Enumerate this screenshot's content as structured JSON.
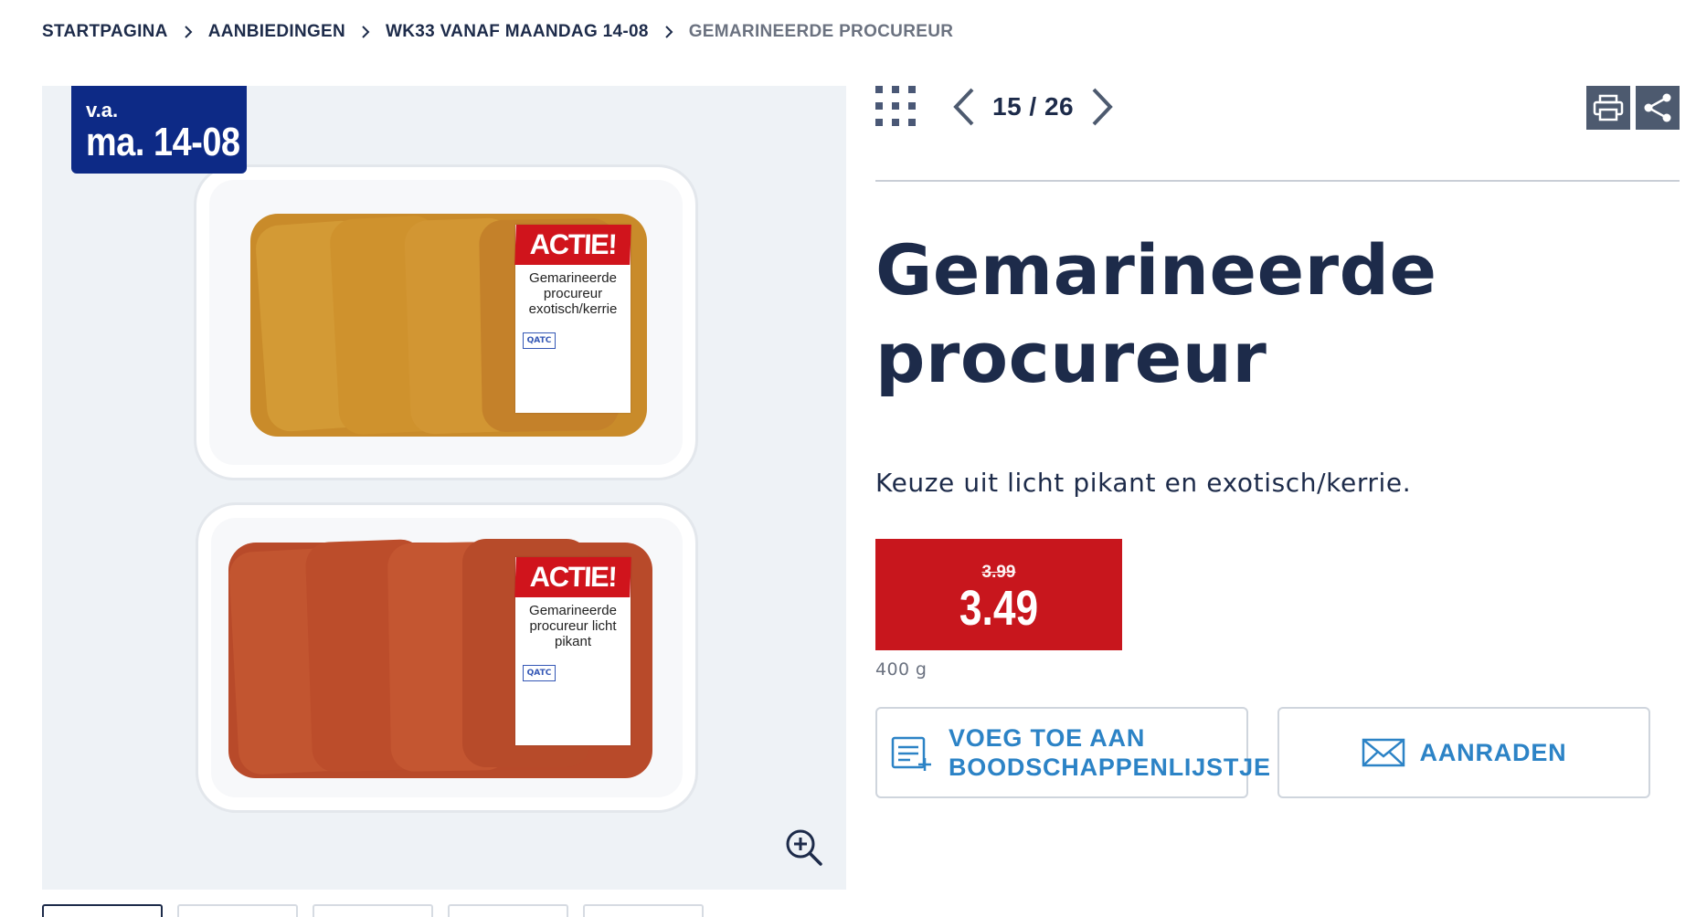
{
  "breadcrumb": {
    "items": [
      {
        "label": "STARTPAGINA"
      },
      {
        "label": "AANBIEDINGEN"
      },
      {
        "label": "WK33 VANAF MAANDAG 14-08"
      },
      {
        "label": "GEMARINEERDE PROCUREUR"
      }
    ]
  },
  "gallery": {
    "badge_prefix": "v.a.",
    "badge_date": "ma. 14-08",
    "zoom_icon": "zoom-in-icon",
    "labels": {
      "top": {
        "badge": "ACTIE!",
        "text": "Gemarineerde procureur exotisch/kerrie"
      },
      "bottom": {
        "badge": "ACTIE!",
        "text": "Gemarineerde procureur licht pikant"
      },
      "qa": "QATC"
    },
    "thumbnail_count": 5
  },
  "toolbar": {
    "grid_icon": "grid-icon",
    "prev_icon": "chevron-left-icon",
    "next_icon": "chevron-right-icon",
    "pager": "15 / 26",
    "print_icon": "printer-icon",
    "share_icon": "share-icon"
  },
  "product": {
    "title": "Gemarineerde procureur",
    "description": "Keuze uit licht pikant en exotisch/kerrie.",
    "old_price": "3.99",
    "price": "3.49",
    "unit": "400 g"
  },
  "actions": {
    "shopping_list_label": "VOEG TOE AAN BOODSCHAPPENLIJSTJE",
    "recommend_label": "AANRADEN"
  },
  "colors": {
    "navy": "#1d2b4a",
    "badge_blue": "#0d2a86",
    "price_red": "#c8161d",
    "link_blue": "#2c83c6",
    "icon_gray": "#4d5a6f"
  }
}
